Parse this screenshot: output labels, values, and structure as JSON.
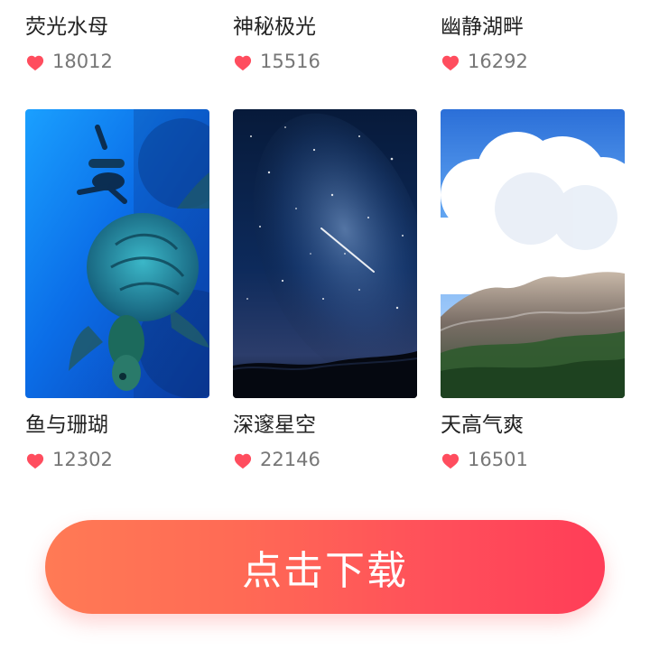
{
  "items_top": [
    {
      "title": "荧光水母",
      "likes": "18012"
    },
    {
      "title": "神秘极光",
      "likes": "15516"
    },
    {
      "title": "幽静湖畔",
      "likes": "16292"
    }
  ],
  "items_bottom": [
    {
      "title": "鱼与珊瑚",
      "likes": "12302"
    },
    {
      "title": "深邃星空",
      "likes": "22146"
    },
    {
      "title": "天高气爽",
      "likes": "16501"
    }
  ],
  "cta": {
    "label": "点击下载"
  },
  "colors": {
    "heart": "#ff4d5e",
    "cta_start": "#ff7a55",
    "cta_end": "#ff3d58"
  },
  "icons": {
    "like": "heart-icon"
  }
}
